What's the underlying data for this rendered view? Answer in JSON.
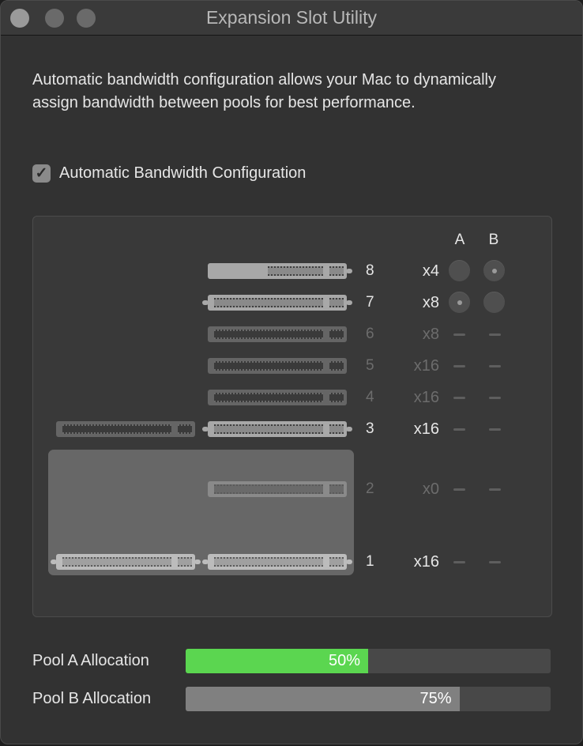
{
  "window": {
    "title": "Expansion Slot Utility",
    "controls": [
      "close",
      "minimize",
      "zoom"
    ]
  },
  "description": "Automatic bandwidth configuration allows your Mac to dynamically assign bandwidth between pools for best performance.",
  "auto_config": {
    "label": "Automatic Bandwidth Configuration",
    "checked": true,
    "check_glyph": "✓"
  },
  "slot_table": {
    "columns": {
      "a": "A",
      "b": "B"
    },
    "dash_glyph": "",
    "slots": [
      {
        "number": "8",
        "lanes": "x4",
        "enabled": true,
        "pool_a": "radio-off",
        "pool_b": "radio-on"
      },
      {
        "number": "7",
        "lanes": "x8",
        "enabled": true,
        "pool_a": "radio-on",
        "pool_b": "radio-off"
      },
      {
        "number": "6",
        "lanes": "x8",
        "enabled": false,
        "pool_a": "dash",
        "pool_b": "dash"
      },
      {
        "number": "5",
        "lanes": "x16",
        "enabled": false,
        "pool_a": "dash",
        "pool_b": "dash"
      },
      {
        "number": "4",
        "lanes": "x16",
        "enabled": false,
        "pool_a": "dash",
        "pool_b": "dash"
      },
      {
        "number": "3",
        "lanes": "x16",
        "enabled": true,
        "pool_a": "dash",
        "pool_b": "dash"
      },
      {
        "number": "2",
        "lanes": "x0",
        "enabled": false,
        "pool_a": "dash",
        "pool_b": "dash"
      },
      {
        "number": "1",
        "lanes": "x16",
        "enabled": true,
        "pool_a": "dash",
        "pool_b": "dash"
      }
    ]
  },
  "pools": [
    {
      "label": "Pool A Allocation",
      "percent": 50,
      "percent_text": "50%",
      "color": "#5bd650"
    },
    {
      "label": "Pool B Allocation",
      "percent": 75,
      "percent_text": "75%",
      "color": "#808080"
    }
  ]
}
